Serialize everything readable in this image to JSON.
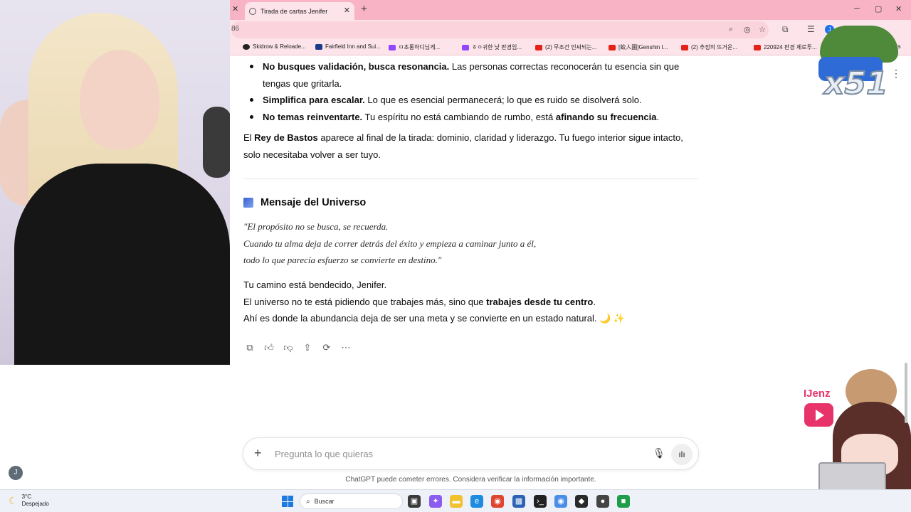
{
  "browser": {
    "tab_title": "Tirada de cartas Jenifer",
    "url_fragment": "86",
    "profile_initial": "J",
    "bookmarks": [
      "Skidrow & Reloade...",
      "Fairfield Inn and Sui...",
      "ㅁ초롱하디님게...",
      "ㅎㅇ귀한 낮 판경임...",
      "(2) 무조건 인싸되는...",
      "[蛟人圖]Genshin I...",
      "(2) 추정의 뜨거운...",
      "220924 판경 제로투...",
      "rks"
    ],
    "colors": {
      "tabbar": "#f8b4c4",
      "toolbar": "#fde4ea"
    }
  },
  "chat": {
    "bullets": [
      {
        "bold": "No busques validación, busca resonancia.",
        "text": " Las personas correctas reconocerán tu esencia sin que tengas que gritarla."
      },
      {
        "bold": "Simplifica para escalar.",
        "text": " Lo que es esencial permanecerá; lo que es ruido se disolverá solo."
      },
      {
        "bold": "No temas reinventarte.",
        "text": " Tu espíritu no está cambiando de rumbo, está ",
        "bold2": "afinando su frecuencia",
        "end": "."
      }
    ],
    "king_para": {
      "pre": "El ",
      "bold": "Rey de Bastos",
      "post": " aparece al final de la tirada: dominio, claridad y liderazgo. Tu fuego interior sigue intacto, solo necesitaba volver a ser tuyo."
    },
    "section_heading": "Mensaje del Universo",
    "quote_lines": [
      "\"El propósito no se busca, se recuerda.",
      "Cuando tu alma deja de correr detrás del éxito y empieza a caminar junto a él,",
      "todo lo que parecía esfuerzo se convierte en destino.\""
    ],
    "closing": {
      "line1": "Tu camino está bendecido, Jenifer.",
      "line2_pre": "El universo no te está pidiendo que trabajes más, sino que ",
      "line2_bold": "trabajes desde tu centro",
      "line2_end": ".",
      "line3": "Ahí es donde la abundancia deja de ser una meta y se convierte en un estado natural. 🌙 ✨"
    },
    "action_icons": [
      "copy-icon",
      "thumbs-up-icon",
      "thumbs-down-icon",
      "share-icon",
      "regenerate-icon",
      "more-icon"
    ]
  },
  "composer": {
    "placeholder": "Pregunta lo que quieras",
    "disclaimer": "ChatGPT puede cometer errores. Considera verificar la información importante.",
    "sidebar_avatar": "J"
  },
  "overlay": {
    "emote_count": "x51",
    "streamer_name": "IJenz"
  },
  "taskbar": {
    "temperature": "3°C",
    "condition": "Despejado",
    "search_label": "Buscar"
  }
}
